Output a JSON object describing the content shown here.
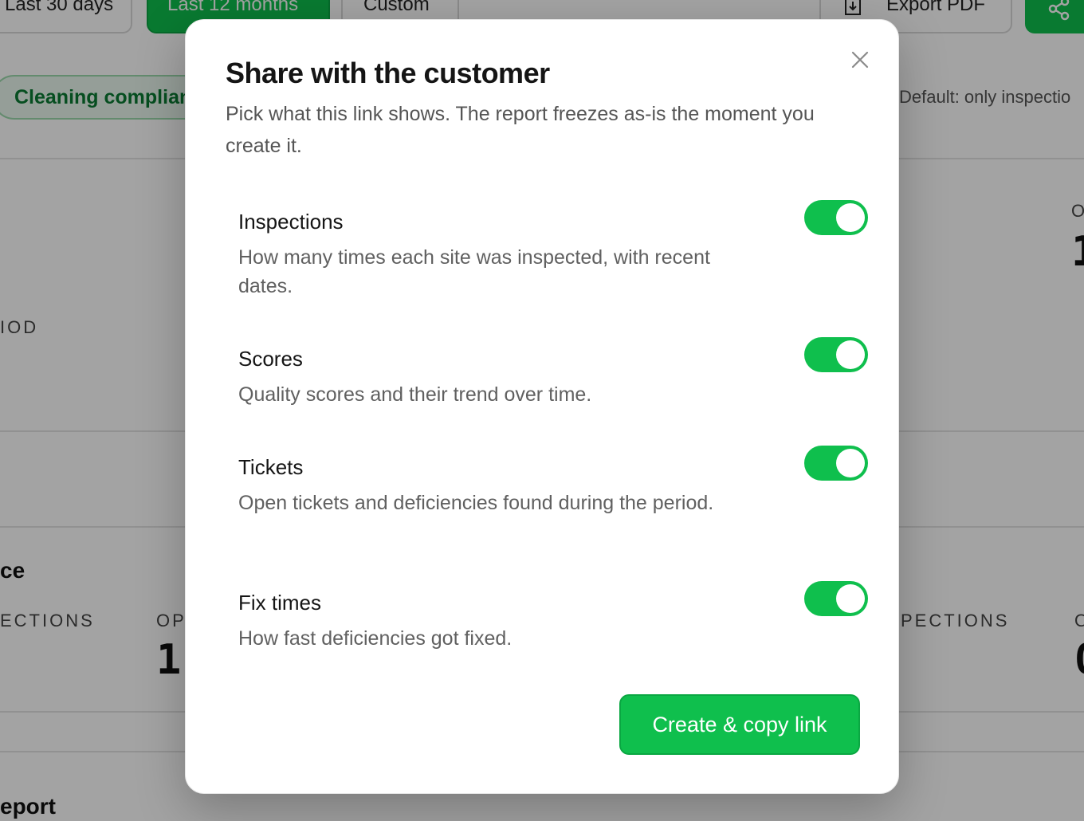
{
  "background": {
    "range_buttons": [
      "Last 30 days",
      "Last 12 months",
      "Custom"
    ],
    "export_label": "Export PDF",
    "filter_pill": "Cleaning complian",
    "default_note": "Default: only inspectio",
    "fragments": {
      "period_caps": "IOD",
      "section_head": "ce",
      "inspections_caps_left": "ECTIONS",
      "open_caps": "OP",
      "open_value": "1",
      "inspections_caps_right": "PECTIONS",
      "right_caps": "O",
      "right_value": "1",
      "right_value_2": "0",
      "report_head": "eport"
    }
  },
  "modal": {
    "title": "Share with the customer",
    "subtitle": "Pick what this link shows. The report freezes as-is the moment you create it.",
    "options": [
      {
        "title": "Inspections",
        "desc": "How many times each site was inspected, with recent dates.",
        "enabled": true
      },
      {
        "title": "Scores",
        "desc": "Quality scores and their trend over time.",
        "enabled": true
      },
      {
        "title": "Tickets",
        "desc": "Open tickets and deficiencies found during the period.",
        "enabled": true
      },
      {
        "title": "Fix times",
        "desc": "How fast deficiencies got fixed.",
        "enabled": true
      }
    ],
    "primary_button": "Create & copy link"
  },
  "colors": {
    "accent": "#0fbf4d",
    "overlay": "rgba(0,0,0,0.36)"
  },
  "icons": [
    "close-icon",
    "file-download-icon",
    "share-icon"
  ]
}
